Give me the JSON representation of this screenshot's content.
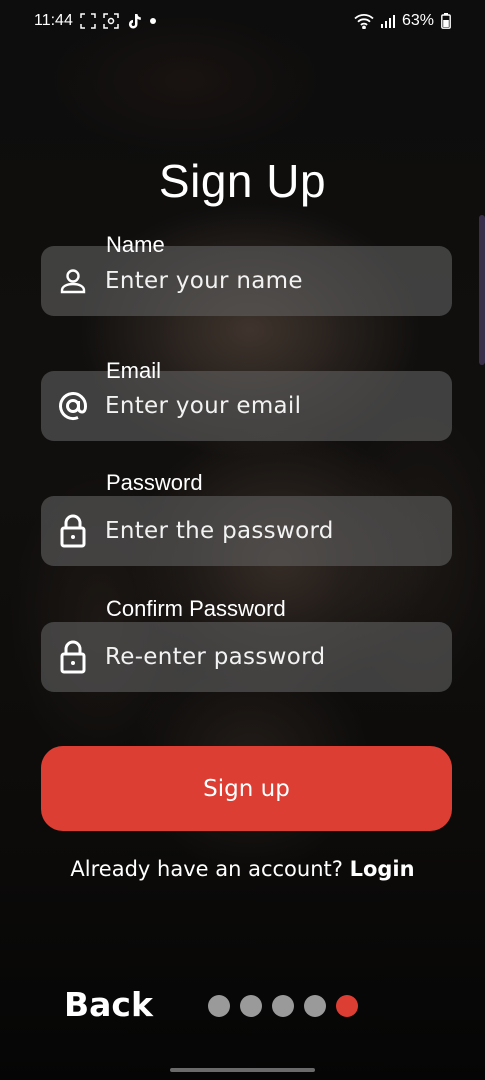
{
  "status_bar": {
    "time": "11:44",
    "battery_percent": "63%",
    "icons": [
      "screenshot-icon",
      "screen-record-icon",
      "tiktok-icon",
      "notification-dot-icon",
      "wifi-icon",
      "signal-icon",
      "battery-icon"
    ]
  },
  "page": {
    "title": "Sign Up"
  },
  "form": {
    "name": {
      "label": "Name",
      "placeholder": "Enter your name",
      "value": "",
      "icon": "person-icon"
    },
    "email": {
      "label": "Email",
      "placeholder": "Enter your email",
      "value": "",
      "icon": "at-sign-icon"
    },
    "password": {
      "label": "Password",
      "placeholder": "Enter the password",
      "value": "",
      "icon": "lock-icon"
    },
    "confirm_password": {
      "label": "Confirm Password",
      "placeholder": "Re-enter password",
      "value": "",
      "icon": "lock-icon"
    }
  },
  "actions": {
    "signup_label": "Sign up",
    "login_prompt": "Already have an account?",
    "login_label": "Login",
    "back_label": "Back"
  },
  "pager": {
    "total": 5,
    "active_index": 4
  },
  "colors": {
    "accent": "#dd3e33",
    "inactive_dot": "#9a9a9a",
    "field_bg": "#5f5f5f"
  }
}
